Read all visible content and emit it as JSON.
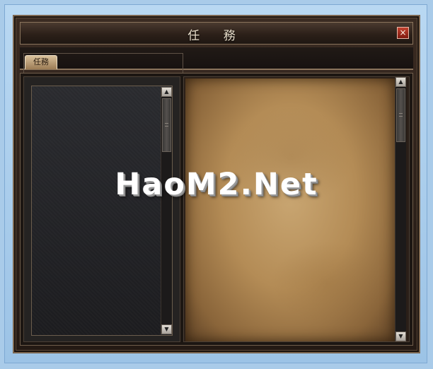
{
  "window": {
    "title": "任 務",
    "close_label": "×"
  },
  "tabs": [
    {
      "label": "任務",
      "selected": true
    }
  ],
  "quest_list": {
    "items": []
  },
  "quest_detail": {
    "text": ""
  },
  "scrollbars": {
    "up_arrow": "▲",
    "down_arrow": "▼"
  },
  "watermark": "HaoM2.Net",
  "colors": {
    "desktop_background": "#a9cbe9",
    "window_frame": "#7c6751",
    "title_text": "#e7dcc9",
    "close_button": "#b23a28",
    "parchment": "#c9a672",
    "list_background": "#2b2c30"
  },
  "icons": {
    "close": "close-icon",
    "scroll_up": "arrow-up-icon",
    "scroll_down": "arrow-down-icon"
  }
}
